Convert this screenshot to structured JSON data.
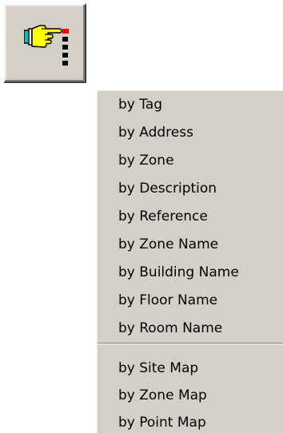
{
  "toolbar": {
    "button_icon": "pointing-hand-icon"
  },
  "menu": {
    "group1": [
      {
        "label": "by Tag"
      },
      {
        "label": "by Address"
      },
      {
        "label": "by Zone"
      },
      {
        "label": "by Description"
      },
      {
        "label": "by Reference"
      },
      {
        "label": "by Zone Name"
      },
      {
        "label": "by Building Name"
      },
      {
        "label": "by Floor Name"
      },
      {
        "label": "by Room Name"
      }
    ],
    "group2": [
      {
        "label": "by Site Map"
      },
      {
        "label": "by Zone  Map"
      },
      {
        "label": "by Point Map"
      }
    ]
  },
  "colors": {
    "menu_background": "#d4d0c8",
    "text": "#000000",
    "hand_fill": "#ffff00",
    "cuff": "#00c0c0",
    "marker_red": "#ff0000"
  }
}
